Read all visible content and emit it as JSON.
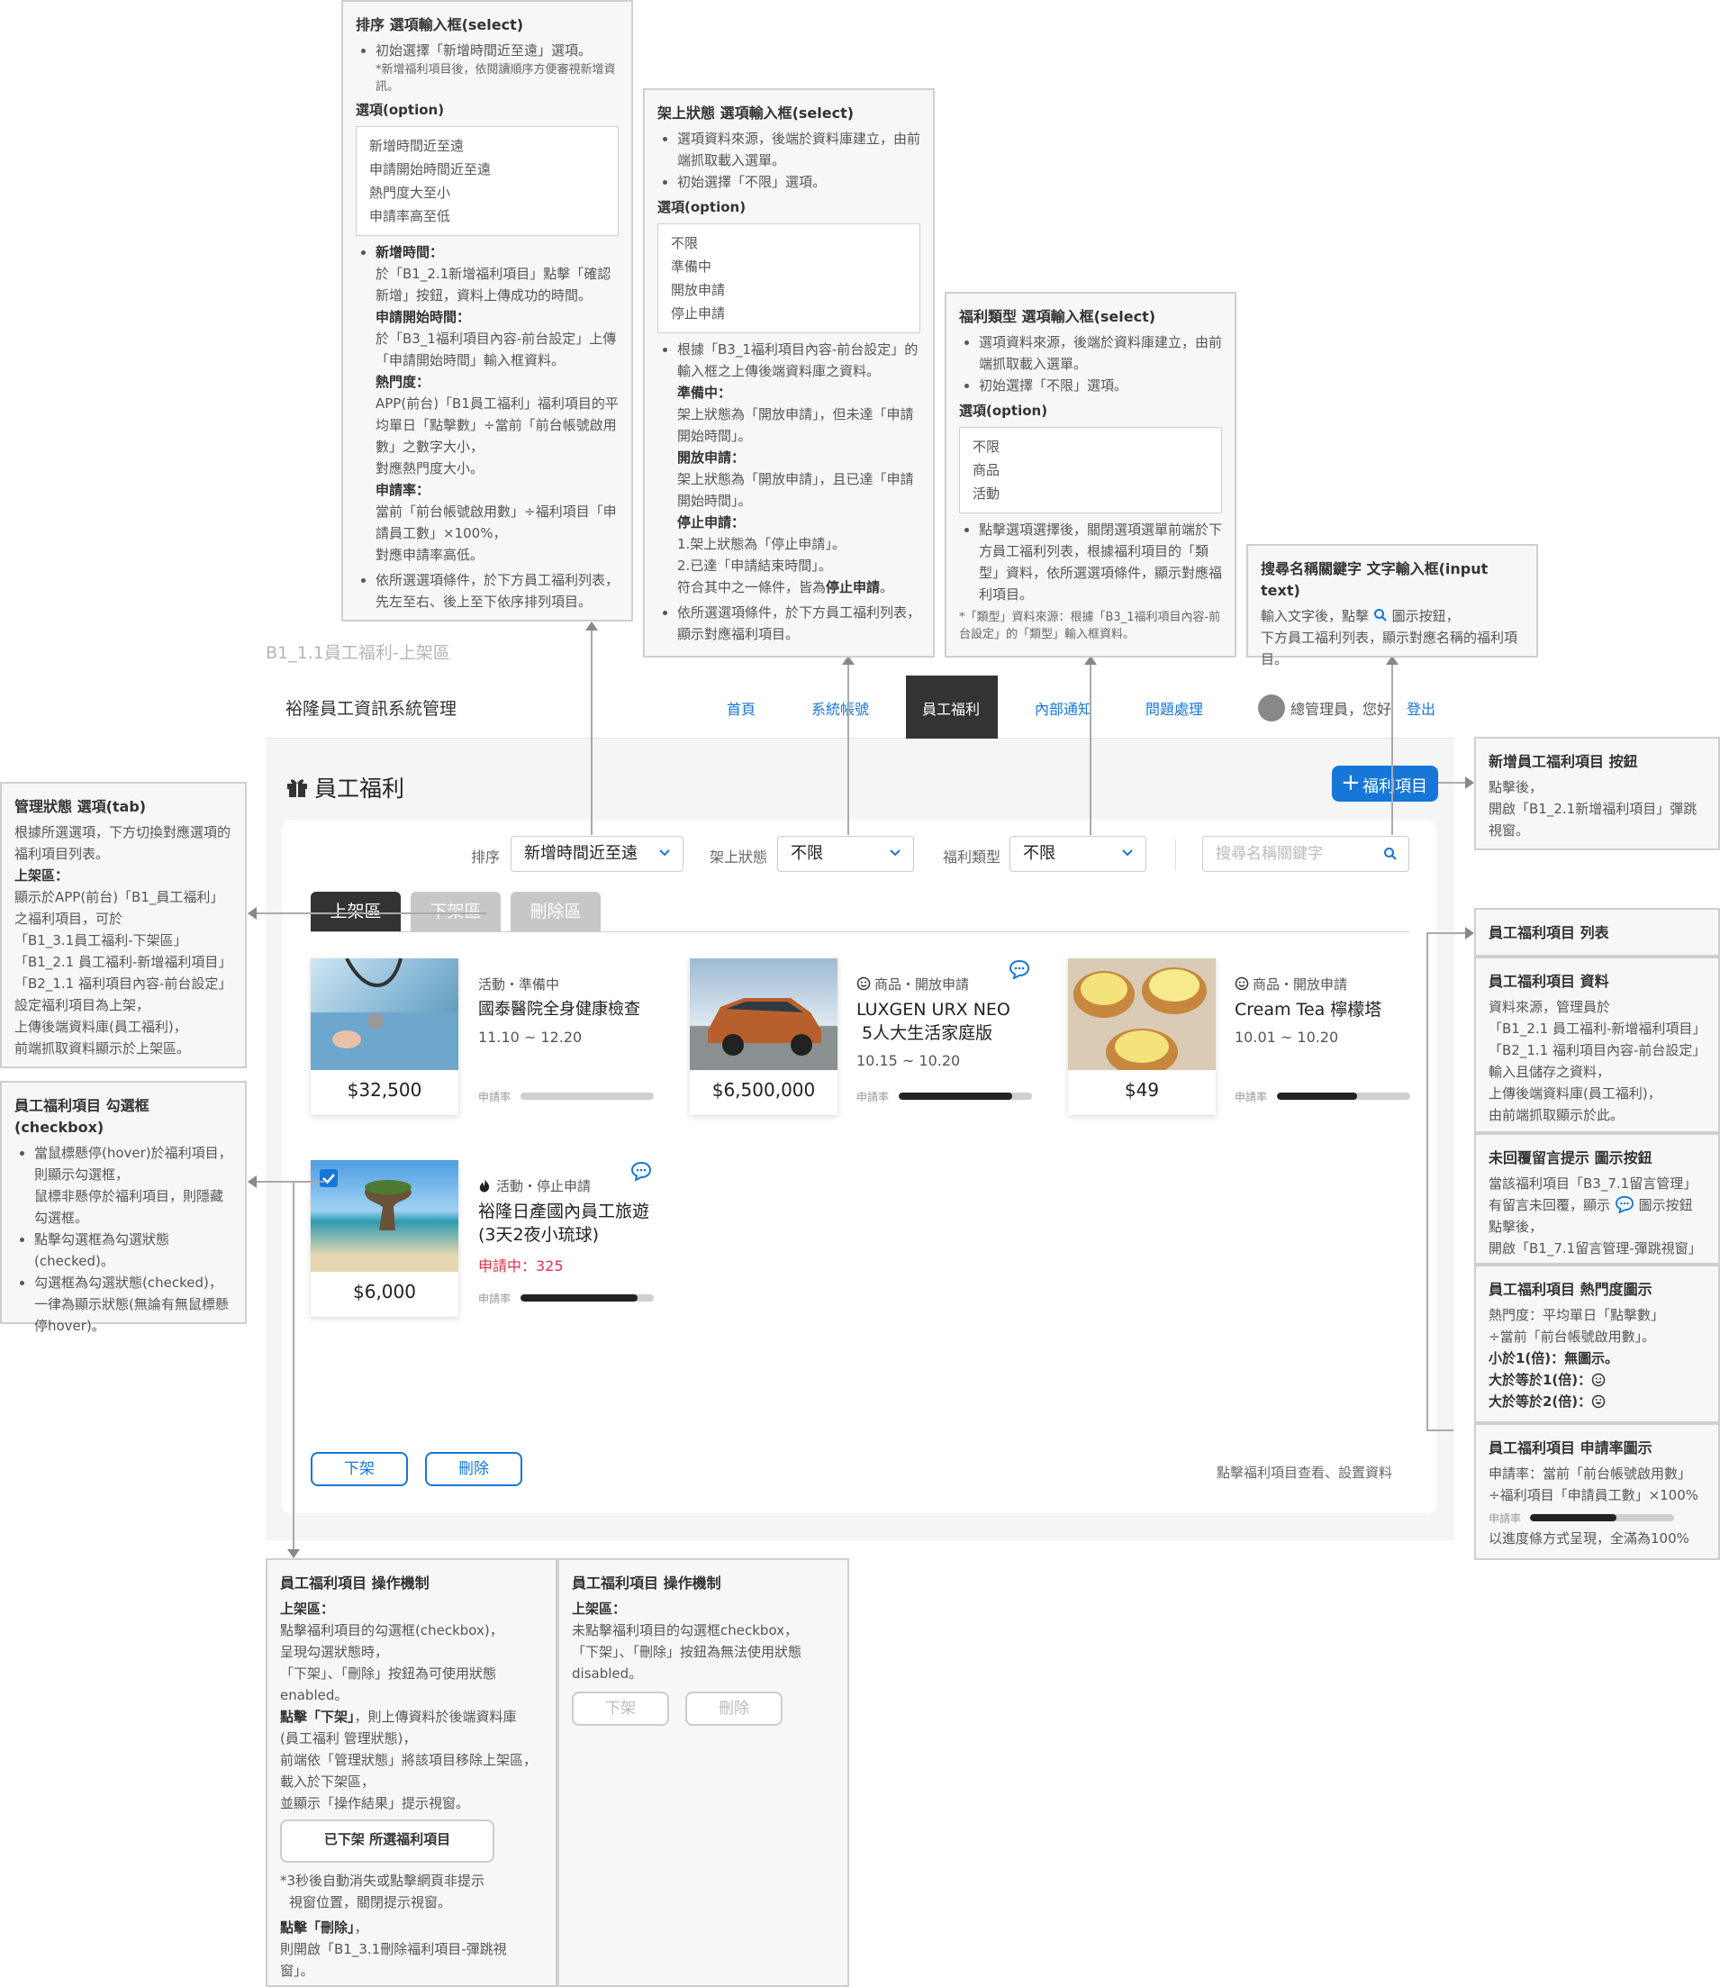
{
  "page": {
    "section_label": "B1_1.1員工福利-上架區",
    "app_title": "裕隆員工資訊系統管理",
    "nav": [
      "首頁",
      "系統帳號",
      "員工福利",
      "內部通知",
      "問題處理"
    ],
    "nav_active": "員工福利",
    "user_text": "總管理員，您好",
    "logout": "登出",
    "heading": "員工福利",
    "add_button": "福利項目",
    "accent_color": "#1677d9",
    "filters": {
      "sort_label": "排序",
      "sort_value": "新增時間近至遠",
      "status_label": "架上狀態",
      "status_value": "不限",
      "type_label": "福利類型",
      "type_value": "不限",
      "search_placeholder": "搜尋名稱關鍵字"
    },
    "tabs": [
      "上架區",
      "下架區",
      "刪除區"
    ],
    "items": [
      {
        "meta": "活動・準備中",
        "title": "國泰醫院全身健康檢查",
        "date": "11.10 ~ 12.20",
        "price": "$32,500",
        "rate_label": "申請率",
        "rate": 0.0,
        "popularity_icon": "",
        "has_message": false,
        "checked": false
      },
      {
        "meta": "商品・開放申請",
        "title": "LUXGEN URX NEO",
        "title2": " 5人大生活家庭版",
        "date": "10.15 ~ 10.20",
        "price": "$6,500,000",
        "rate_label": "申請率",
        "rate": 0.85,
        "popularity_icon": "smile-icon",
        "has_message": true,
        "checked": false
      },
      {
        "meta": "商品・開放申請",
        "title": "Cream Tea 檸檬塔",
        "date": "10.01 ~ 10.20",
        "price": "$49",
        "rate_label": "申請率",
        "rate": 0.6,
        "popularity_icon": "smile-icon",
        "has_message": false,
        "checked": false
      },
      {
        "meta": "活動・停止申請",
        "title": "裕隆日產國內員工旅遊",
        "title2": "(3天2夜小琉球)",
        "applying": "申請中：325",
        "price": "$6,000",
        "rate_label": "申請率",
        "rate": 0.88,
        "popularity_icon": "fire-icon",
        "has_message": true,
        "checked": true
      }
    ],
    "btn_offshelf": "下架",
    "btn_delete": "刪除",
    "hint": "點擊福利項目查看、設置資料"
  },
  "notes": {
    "sort": {
      "title": "排序 選項輸入框(select)",
      "b1": "初始選擇「新增時間近至遠」選項。",
      "b1_small": "*新增福利項目後，依閱讀順序方便審視新增資訊。",
      "opt_title": "選項(option)",
      "options": [
        "新增時間近至遠",
        "申請開始時間近至遠",
        "熱門度大至小",
        "申請率高至低"
      ],
      "d1_t": "新增時間：",
      "d1": "於「B1_2.1新增福利項目」點擊「確認新增」按鈕，資料上傳成功的時間。",
      "d2_t": "申請開始時間：",
      "d2": "於「B3_1福利項目內容-前台設定」上傳「申請開始時間」輸入框資料。",
      "d3_t": "熱門度：",
      "d3": "APP(前台)「B1員工福利」福利項目的平均單日「點擊數」÷當前「前台帳號啟用數」之數字大小，",
      "d3b": "對應熱門度大小。",
      "d4_t": "申請率：",
      "d4": "當前「前台帳號啟用數」÷福利項目「申請員工數」×100%，",
      "d4b": "對應申請率高低。",
      "b2": "依所選選項條件，於下方員工福利列表，先左至右、後上至下依序排列項目。"
    },
    "status": {
      "title": "架上狀態 選項輸入框(select)",
      "b1": "選項資料來源，後端於資料庫建立，由前端抓取載入選單。",
      "b2": "初始選擇「不限」選項。",
      "opt_title": "選項(option)",
      "options": [
        "不限",
        "準備中",
        "開放申請",
        "停止申請"
      ],
      "b3": "根據「B3_1福利項目內容-前台設定」的輸入框之上傳後端資料庫之資料。",
      "s1_t": "準備中：",
      "s1": "架上狀態為「開放申請」，但未達「申請開始時間」。",
      "s2_t": "開放申請：",
      "s2": "架上狀態為「開放申請」，且已達「申請開始時間」。",
      "s3_t": "停止申請：",
      "s3a": "1.架上狀態為「停止申請」。",
      "s3b": "2.已達「申請結束時間」。",
      "s3c": "符合其中之一條件，皆為",
      "s3c_b": "停止申請",
      "s3c_e": "。",
      "b4": "依所選選項條件，於下方員工福利列表，顯示對應福利項目。"
    },
    "type": {
      "title": "福利類型 選項輸入框(select)",
      "b1": "選項資料來源，後端於資料庫建立，由前端抓取載入選單。",
      "b2": "初始選擇「不限」選項。",
      "opt_title": "選項(option)",
      "options": [
        "不限",
        "商品",
        "活動"
      ],
      "b3": "點擊選項選擇後，關閉選項選單前端於下方員工福利列表，根據福利項目的「類型」資料，依所選選項條件，顯示對應福利項目。",
      "small": "*「類型」資料來源：根據「B3_1福利項目內容-前台設定」的「類型」輸入框資料。"
    },
    "search": {
      "title": "搜尋名稱關鍵字 文字輸入框(input text)",
      "l1": "輸入文字後，點擊",
      "l1b": "圖示按鈕，",
      "l2": "下方員工福利列表，顯示對應名稱的福利項目。"
    },
    "add": {
      "title": "新增員工福利項目 按鈕",
      "l1": "點擊後，",
      "l2": "開啟「B1_2.1新增福利項目」彈跳視窗。"
    },
    "tabs": {
      "title": "管理狀態 選項(tab)",
      "l1": "根據所選選項，下方切換對應選項的福利項目列表。",
      "s_t": "上架區：",
      "l2": "顯示於APP(前台)「B1_員工福利」之福利項目，可於",
      "l3": "「B1_3.1員工福利-下架區」",
      "l4": "「B1_2.1 員工福利-新增福利項目」",
      "l5": "「B2_1.1 福利項目內容-前台設定」",
      "l6": "設定福利項目為上架，",
      "l7": "上傳後端資料庫(員工福利)，",
      "l8": "前端抓取資料顯示於上架區。"
    },
    "checkbox": {
      "title": "員工福利項目 勾選框(checkbox)",
      "b1": "當鼠標懸停(hover)於福利項目，則顯示勾選框，",
      "b1b": "鼠標非懸停於福利項目，則隱藏勾選框。",
      "b2": "點擊勾選框為勾選狀態(checked)。",
      "b3": "勾選框為勾選狀態(checked)，一律為顯示狀態(無論有無鼠標懸停hover)。"
    },
    "list": {
      "title": "員工福利項目 列表"
    },
    "data": {
      "title": "員工福利項目 資料",
      "l1": "資料來源，管理員於",
      "l2": "「B1_2.1 員工福利-新增福利項目」",
      "l3": "「B2_1.1 福利項目內容-前台設定」",
      "l4": "輸入且儲存之資料，",
      "l5": "上傳後端資料庫(員工福利)，",
      "l6": "由前端抓取顯示於此。"
    },
    "message": {
      "title": "未回覆留言提示 圖示按鈕",
      "l1": "當該福利項目「B3_7.1留言管理」",
      "l2": "有留言未回覆，顯示",
      "l2b": "圖示按鈕",
      "l3": "點擊後，",
      "l4": "開啟「B1_7.1留言管理-彈跳視窗」"
    },
    "hot": {
      "title": "員工福利項目 熱門度圖示",
      "l1": "熱門度：平均單日「點擊數」",
      "l2": "÷當前「前台帳號啟用數」。",
      "l3": "小於1(倍)：無圖示。",
      "l4": "大於等於1(倍)：",
      "l5": "大於等於2(倍)："
    },
    "rate": {
      "title": "員工福利項目 申請率圖示",
      "l1": "申請率：當前「前台帳號啟用數」",
      "l2": "÷福利項目「申請員工數」×100%",
      "bar_label": "申請率",
      "bar_value": 0.6,
      "l3": "以進度條方式呈現，全滿為100%"
    },
    "op1": {
      "title": "員工福利項目 操作機制",
      "s_t": "上架區：",
      "l1": "點擊福利項目的勾選框(checkbox)，",
      "l2": "呈現勾選狀態時，",
      "l3": "「下架」、「刪除」按鈕為可使用狀態",
      "l4": "enabled。",
      "l5_t": "點擊「下架」",
      "l5": "，則上傳資料於後端資料庫",
      "l6": "(員工福利 管理狀態)，",
      "l7": "前端依「管理狀態」將該項目移除上架區，",
      "l8": "載入於下架區，",
      "l9": "並顯示「操作結果」提示視窗。",
      "toast": "已下架 所選福利項目",
      "l10": "*3秒後自動消失或點擊網頁非提示",
      "l11": "視窗位置，關閉提示視窗。",
      "l12_t": "點擊「刪除」",
      "l12": "，",
      "l13": "則開啟「B1_3.1刪除福利項目-彈跳視",
      "l14": "窗」。"
    },
    "op2": {
      "title": "員工福利項目 操作機制",
      "s_t": "上架區：",
      "l1": "未點擊福利項目的勾選框checkbox，",
      "l2": "「下架」、「刪除」按鈕為無法使用狀態",
      "l3": "disabled。",
      "btn1": "下架",
      "btn2": "刪除"
    }
  }
}
